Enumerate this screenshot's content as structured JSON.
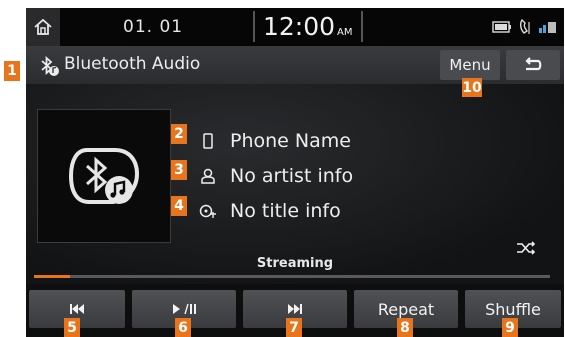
{
  "status_bar": {
    "date": "01. 01",
    "time": "12:00",
    "ampm": "AM"
  },
  "title_bar": {
    "title": "Bluetooth Audio",
    "menu_label": "Menu"
  },
  "track_info": {
    "phone_name": "Phone Name",
    "artist": "No artist info",
    "title": "No title info"
  },
  "playback": {
    "status": "Streaming",
    "progress_fraction": 0.07
  },
  "controls": {
    "prev_label": "⏮",
    "play_pause_label": "▶/❚❚",
    "next_label": "⏭",
    "repeat_label": "Repeat",
    "shuffle_label": "Shuffle"
  },
  "callouts": [
    "1",
    "2",
    "3",
    "4",
    "5",
    "6",
    "7",
    "8",
    "9",
    "10"
  ],
  "colors": {
    "accent": "#e8741c",
    "screen_bg": "#0e0e0f",
    "button": "#4a4b4f"
  },
  "icons": [
    "home-icon",
    "battery-icon",
    "call-icon",
    "bluetooth-signal-icon",
    "bluetooth-audio-icon",
    "back-icon",
    "phone-icon",
    "artist-icon",
    "title-icon",
    "shuffle-icon"
  ]
}
